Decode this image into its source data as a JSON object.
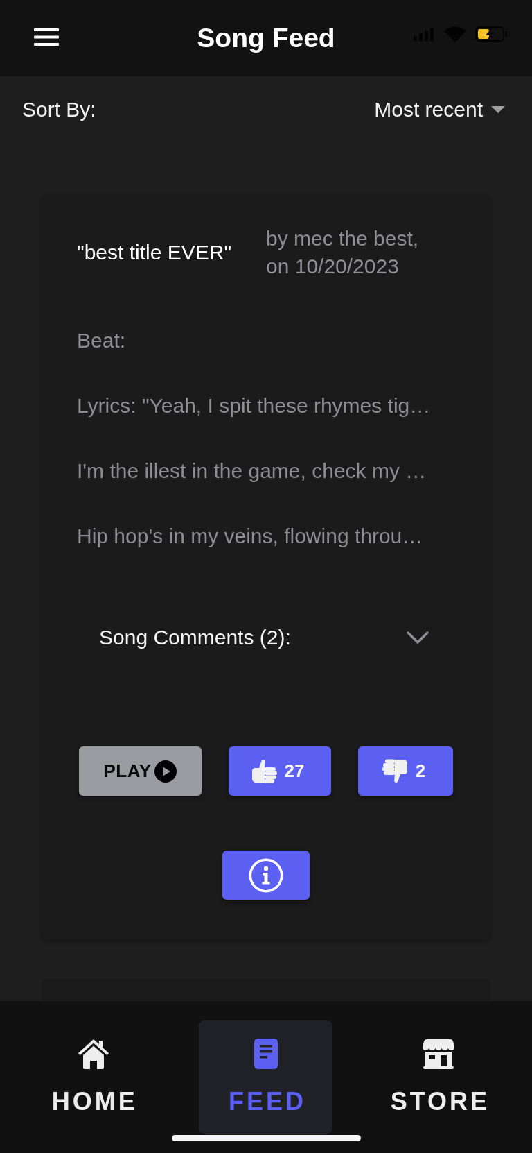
{
  "header": {
    "title": "Song Feed"
  },
  "sort": {
    "label": "Sort By:",
    "value": "Most recent"
  },
  "songs": [
    {
      "title": "\"best title EVER\"",
      "byline": "by mec the best, on 10/20/2023",
      "beat": "Beat:",
      "lyrics": [
        "Lyrics: \"Yeah, I spit these rhymes tig…",
        "I'm the illest in the game, check my …",
        "Hip hop's in my veins, flowing throu…"
      ],
      "comments": {
        "label": "Song Comments (2):",
        "expanded": false
      },
      "play_label": "PLAY",
      "likes": "27",
      "dislikes": "2"
    }
  ],
  "nav": [
    {
      "kind": "home",
      "label": "HOME",
      "selected": false
    },
    {
      "kind": "feed",
      "label": "FEED",
      "selected": true
    },
    {
      "kind": "store",
      "label": "STORE",
      "selected": false
    }
  ]
}
